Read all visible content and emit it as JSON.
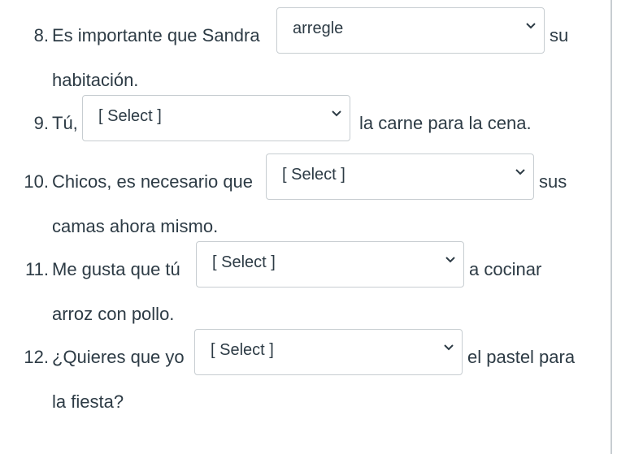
{
  "questions": [
    {
      "number": "8.",
      "before": "Es importante que Sandra",
      "selected": "arregle",
      "after": "su",
      "continuation": "habitación."
    },
    {
      "number": "9.",
      "before": "Tú,",
      "selected": "[ Select ]",
      "after": "la carne para la cena.",
      "continuation": ""
    },
    {
      "number": "10.",
      "before": "Chicos, es necesario que",
      "selected": "[ Select ]",
      "after": "sus",
      "continuation": "camas ahora mismo."
    },
    {
      "number": "11.",
      "before": "Me gusta que tú",
      "selected": "[ Select ]",
      "after": "a cocinar",
      "continuation": "arroz con pollo."
    },
    {
      "number": "12.",
      "before": "¿Quieres que yo",
      "selected": "[ Select ]",
      "after": "el pastel para",
      "continuation": "la fiesta?"
    }
  ],
  "icons": {
    "dropdown": "chevron-down-icon"
  },
  "colors": {
    "text": "#2d3b45",
    "border": "#c7cdd1"
  }
}
